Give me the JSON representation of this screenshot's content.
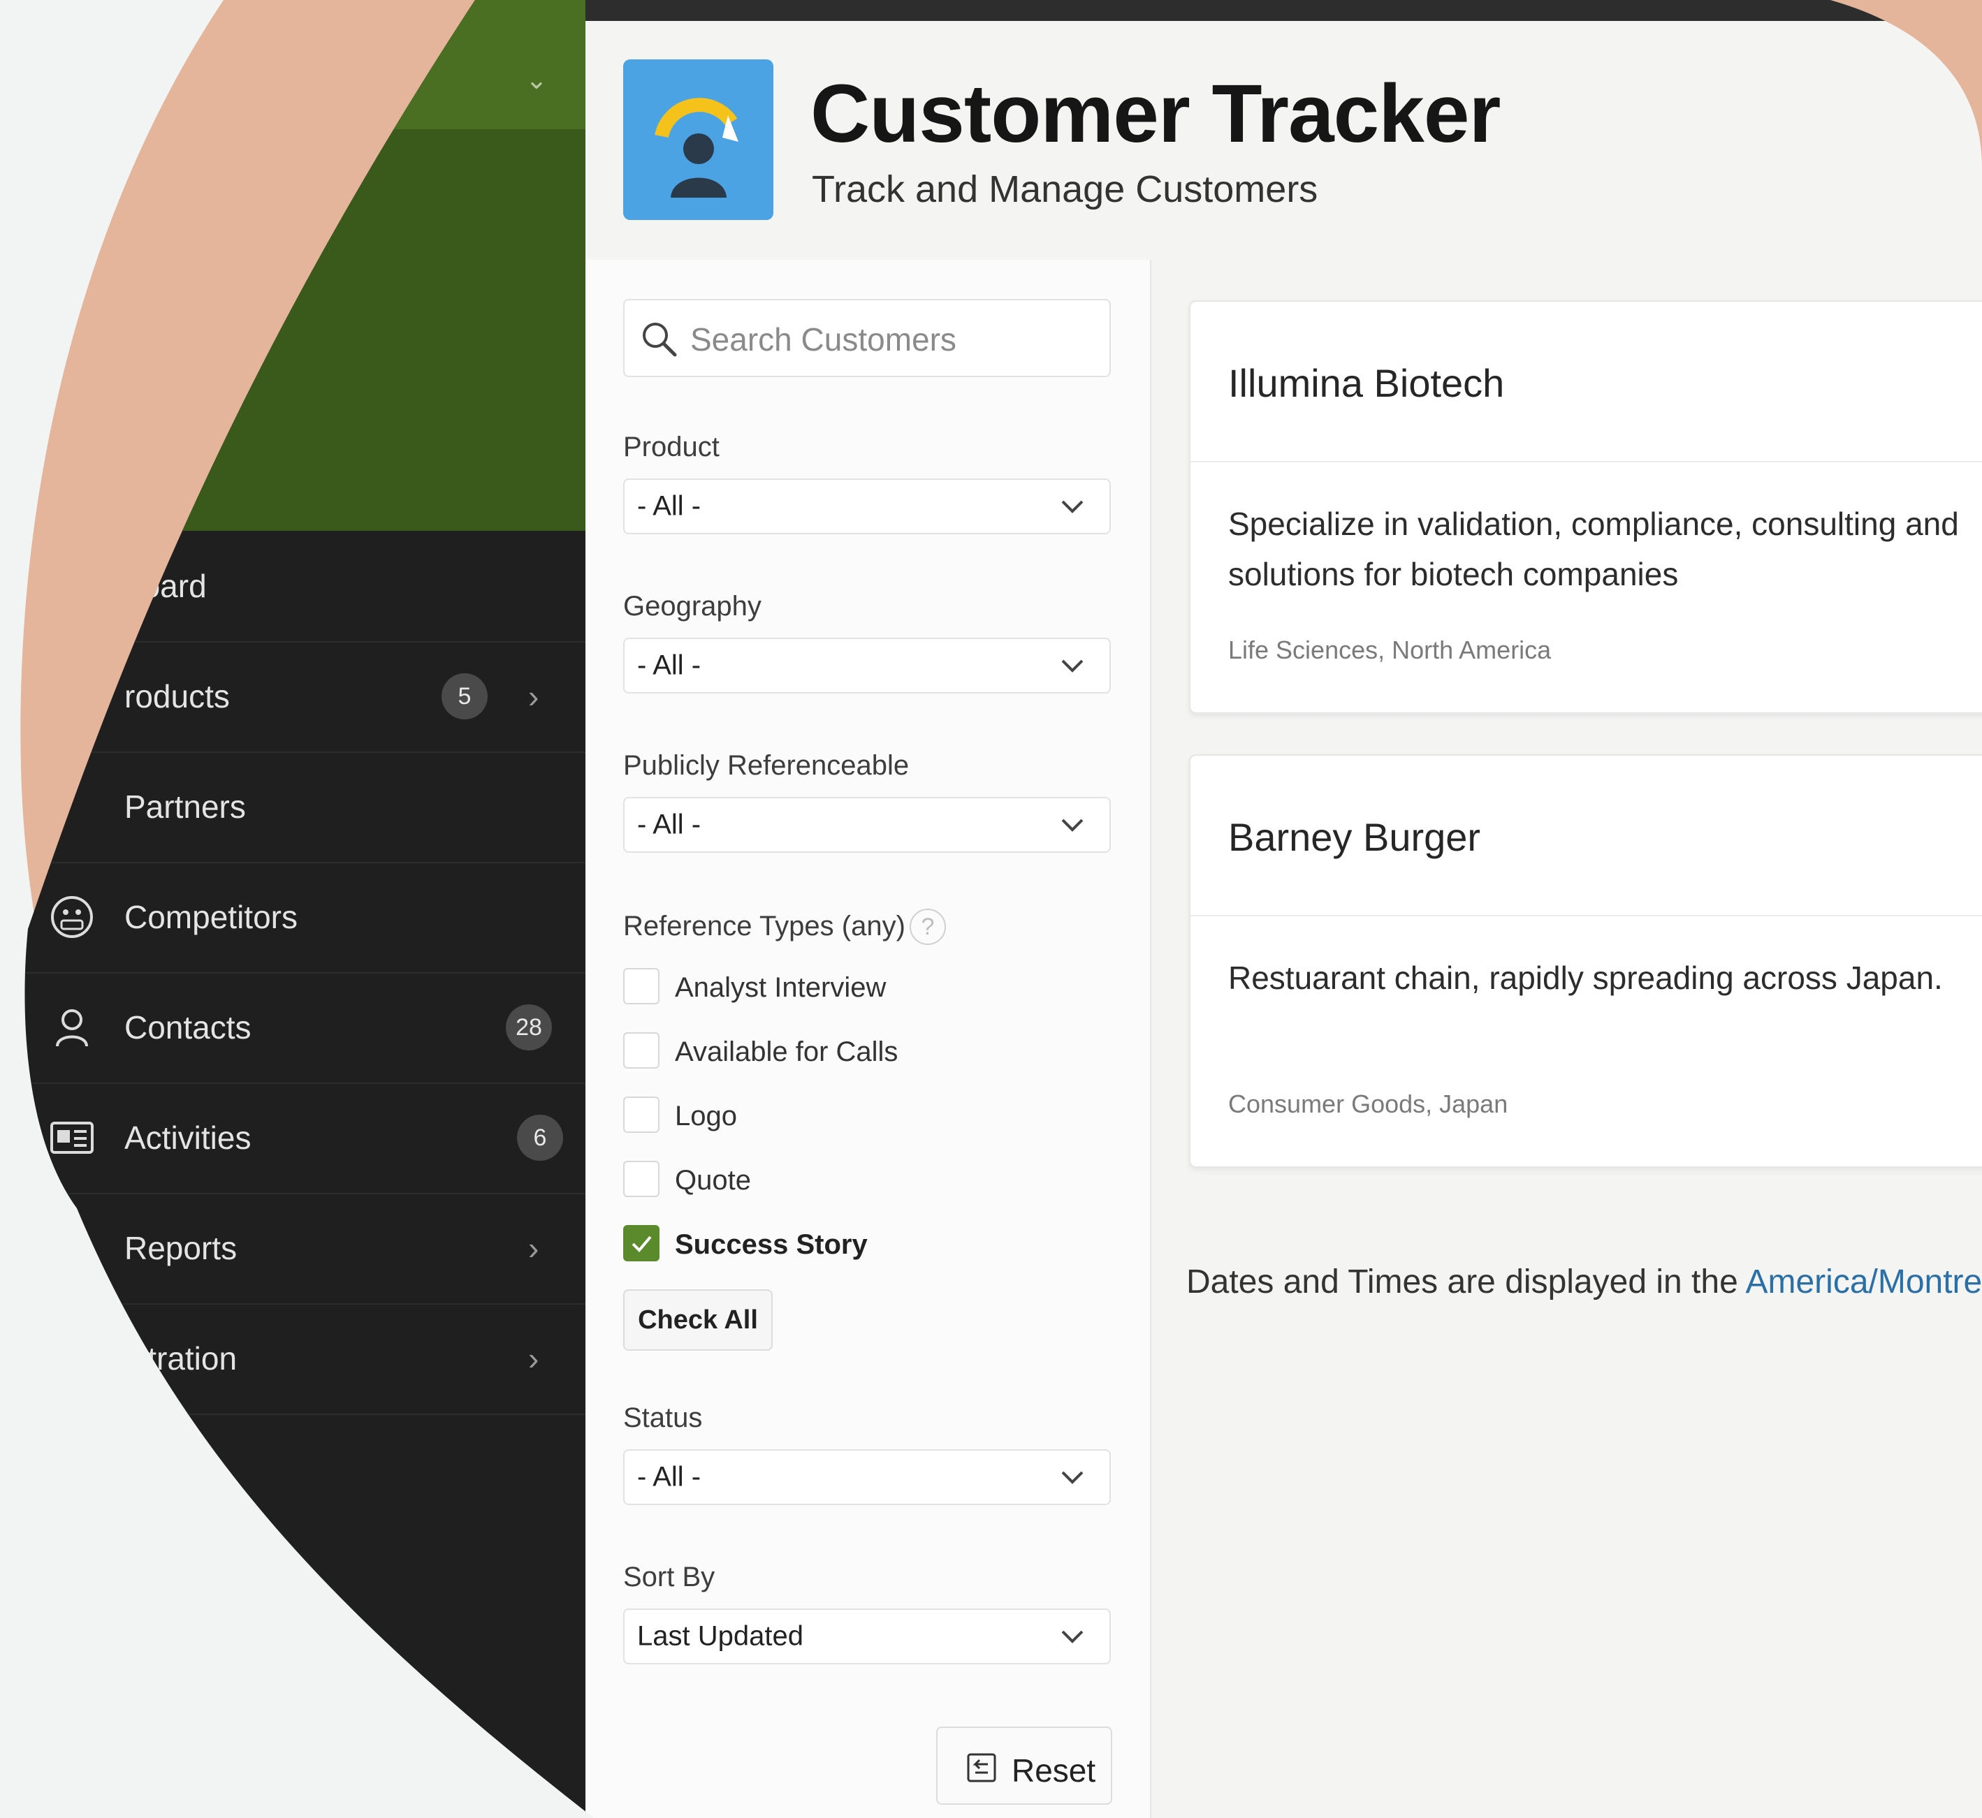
{
  "app": {
    "title": "Customer Tracker",
    "subtitle": "Track and Manage Customers",
    "accent_color": "#4ba3e3",
    "logo_icon": "customer-gauge-logo"
  },
  "sidebar": {
    "items": [
      {
        "label": "board",
        "icon": "dashboard-icon"
      },
      {
        "label": "roducts",
        "badge": "5",
        "icon": "products-icon",
        "has_submenu": true
      },
      {
        "label": "Partners",
        "icon": "partners-icon"
      },
      {
        "label": "Competitors",
        "icon": "competitors-icon"
      },
      {
        "label": "Contacts",
        "badge": "28",
        "icon": "contacts-icon"
      },
      {
        "label": "Activities",
        "badge": "6",
        "icon": "activities-icon"
      },
      {
        "label": "Reports",
        "icon": "reports-icon",
        "has_submenu": true
      },
      {
        "label": "istration",
        "icon": "administration-icon",
        "has_submenu": true
      }
    ]
  },
  "filters": {
    "search": {
      "placeholder": "Search Customers",
      "value": ""
    },
    "product": {
      "label": "Product",
      "value": "- All -"
    },
    "geography": {
      "label": "Geography",
      "value": "- All -"
    },
    "publicly_referenceable": {
      "label": "Publicly Referenceable",
      "value": "- All -"
    },
    "reference_types": {
      "label": "Reference Types (any)",
      "options": [
        {
          "label": "Analyst Interview",
          "checked": false
        },
        {
          "label": "Available for Calls",
          "checked": false
        },
        {
          "label": "Logo",
          "checked": false
        },
        {
          "label": "Quote",
          "checked": false
        },
        {
          "label": "Success Story",
          "checked": true
        }
      ],
      "check_all_label": "Check All"
    },
    "status": {
      "label": "Status",
      "value": "- All -"
    },
    "sort_by": {
      "label": "Sort By",
      "value": "Last Updated"
    },
    "reset_label": "Reset"
  },
  "customers": [
    {
      "name": "Illumina Biotech",
      "description_line1": "Specialize in validation, compliance, consulting and",
      "description_line2": "solutions for biotech companies",
      "meta": "Life Sciences, North America"
    },
    {
      "name": "Barney Burger",
      "description_line1": "Restuarant chain, rapidly spreading across Japan.",
      "meta": "Consumer Goods, Japan"
    }
  ],
  "footer": {
    "tz_text": "Dates and Times are displayed in the ",
    "tz_link": "America/Montre"
  },
  "colors": {
    "sidebar_dark": "#1f1f1f",
    "sidebar_green": "#3a5a1b",
    "checkbox_checked": "#5a8a2c",
    "link": "#2a6fa6",
    "background_shape": "#e4b49b"
  }
}
